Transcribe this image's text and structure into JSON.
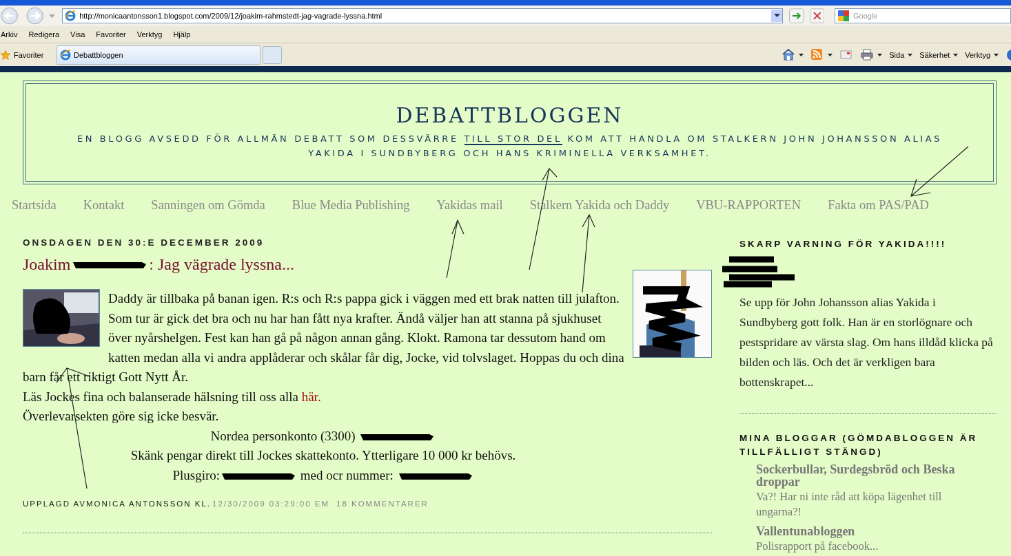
{
  "browser": {
    "address": "http://monicaantonsson1.blogspot.com/2009/12/joakim-rahmstedt-jag-vagrade-lyssna.html",
    "search_placeholder": "Google",
    "menu": [
      "Arkiv",
      "Redigera",
      "Visa",
      "Favoriter",
      "Verktyg",
      "Hjälp"
    ],
    "favorites": "Favoriter",
    "tabs": [
      {
        "label": "Debattbloggen",
        "selected": true
      }
    ],
    "toolbar": [
      {
        "kind": "home",
        "has_menu": true
      },
      {
        "kind": "feeds",
        "has_menu": true
      },
      {
        "kind": "mail",
        "has_menu": false
      },
      {
        "kind": "print",
        "has_menu": true
      },
      {
        "kind": "menu",
        "label": "Sida",
        "has_menu": true
      },
      {
        "kind": "menu",
        "label": "Säkerhet",
        "has_menu": true
      },
      {
        "kind": "menu",
        "label": "Verktyg",
        "has_menu": true
      },
      {
        "kind": "help",
        "has_menu": false
      }
    ]
  },
  "blog": {
    "title": "DEBATTBLOGGEN",
    "description": [
      {
        "text": "EN BLOGG AVSEDD FÖR ALLMÄN DEBATT SOM DESSVÄRRE ",
        "underlined": false
      },
      {
        "text": "TILL STOR DEL",
        "underlined": true
      },
      {
        "text": " KOM ATT HANDLA OM STALKERN JOHN JOHANSSON ALIAS YAKIDA I SUNDBYBERG OCH HANS KRIMINELLA VERKSAMHET.",
        "underlined": false
      }
    ],
    "nav": [
      "Startsida",
      "Kontakt",
      "Sanningen om Gömda",
      "Blue Media Publishing",
      "Yakidas mail",
      "Stalkern Yakida och Daddy",
      "VBU-RAPPORTEN",
      "Fakta om PAS/PAD"
    ]
  },
  "post": {
    "date": "ONSDAGEN DEN 30:E DECEMBER 2009",
    "title": [
      {
        "kind": "text",
        "text": "Joakim"
      },
      {
        "kind": "redacted"
      },
      {
        "kind": "text",
        "text": ": Jag vägrade lyssna..."
      }
    ],
    "body": [
      {
        "kind": "paragraph",
        "image": true,
        "parts": [
          {
            "kind": "text",
            "text": "Daddy är tillbaka på banan igen. R:s och R:s pappa gick i väggen med ett brak natten till julafton. Som tur är gick det bra och nu har han fått nya krafter. Ändå väljer han att stanna på sjukhuset över nyårshelgen. Fest kan han gå på någon annan gång. Klokt. Ramona tar dessutom hand om katten medan alla vi andra applåderar och skålar får dig, Jocke, vid tolvslaget. Hoppas du och dina barn får ett riktigt Gott Nytt År."
          }
        ]
      },
      {
        "kind": "paragraph",
        "image": false,
        "parts": [
          {
            "kind": "text",
            "text": "Läs Jockes fina och balanserade hälsning till oss alla "
          },
          {
            "kind": "link",
            "text": "här."
          }
        ]
      },
      {
        "kind": "paragraph",
        "image": false,
        "parts": [
          {
            "kind": "text",
            "text": "Överlevarsekten göre sig icke besvär."
          }
        ]
      },
      {
        "kind": "centered",
        "image": false,
        "parts": [
          {
            "kind": "text",
            "text": "Nordea personkonto (3300) "
          },
          {
            "kind": "redacted"
          }
        ]
      },
      {
        "kind": "centered",
        "image": false,
        "parts": [
          {
            "kind": "text",
            "text": "Skänk pengar direkt till Jockes skattekonto. Ytterligare 10 000 kr behövs."
          }
        ]
      },
      {
        "kind": "centered",
        "image": false,
        "parts": [
          {
            "kind": "text",
            "text": "Plusgiro:"
          },
          {
            "kind": "redacted"
          },
          {
            "kind": "text",
            "text": " med ocr nummer: "
          },
          {
            "kind": "redacted"
          }
        ]
      }
    ],
    "footer": {
      "author": "UPPLAGD AVMONICA ANTONSSON KL.",
      "time": "12/30/2009 03:29:00 EM",
      "comments": "18 KOMMENTARER"
    }
  },
  "sidebar": [
    {
      "kind": "text",
      "title": "SKARP VARNING FÖR YAKIDA!!!!",
      "text": "Se upp för John Johansson alias Yakida i Sundbyberg gott folk. Han är en storlögnare och pestspridare av värsta slag. Om hans illdåd klicka på bilden och läs. Och det är verkligen bara bottenskrapet..."
    },
    {
      "kind": "bloglist",
      "title": "MINA BLOGGAR (GÖMDABLOGGEN ÄR TILLFÄLLIGT STÄNGD)",
      "items": [
        {
          "name": "Sockerbullar, Surdegsbröd och Beska droppar",
          "snippet": "Va?! Har ni inte råd att köpa lägenhet till ungarna?!"
        },
        {
          "name": "Vallentunabloggen",
          "snippet": "Polisrapport på facebook..."
        }
      ]
    }
  ]
}
